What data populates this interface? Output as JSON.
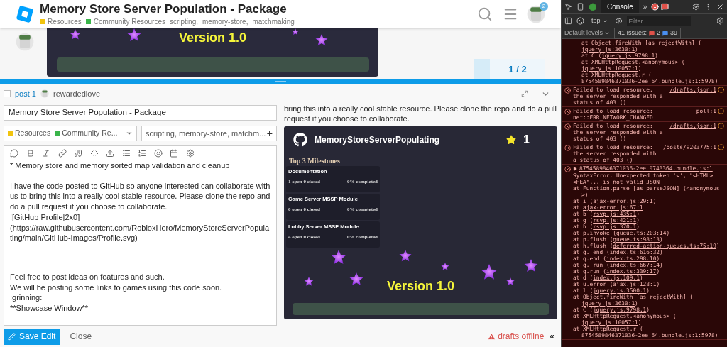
{
  "header": {
    "title": "Memory Store Server Population - Package",
    "categories": [
      {
        "name": "Resources",
        "color": "#f1c40f"
      },
      {
        "name": "Community Resources",
        "color": "#3ab54a"
      }
    ],
    "tags": [
      "scripting,",
      "memory-store,",
      "matchmaking"
    ],
    "notification_count": "2"
  },
  "topic_preview": {
    "version": "Version 1.0"
  },
  "timeline": {
    "position": "1 / 2"
  },
  "composer": {
    "post_link": "post 1",
    "username": "rewardedlove",
    "title_value": "Memory Store Server Population - Package",
    "category_select": [
      {
        "name": "Resources",
        "color": "#f1c40f"
      },
      {
        "name": "Community Re...",
        "color": "#3ab54a"
      }
    ],
    "tags_value": "scripting, memory-store, matchm...",
    "add_tag_label": "+",
    "editor_blocks": [
      {
        "kind": "paragraph",
        "lines": [
          "*  Memory store and memory sorted map validation and cleanup"
        ]
      },
      {
        "kind": "paragraph",
        "lines": [
          "I have the code posted to GitHub so anyone interested can collaborate with us to bring this into a really cool stable resource. Please clone the repo and do a pull request if you choose to collaborate.",
          "![GitHub Profile|2x0]",
          "(https://raw.githubusercontent.com/RobloxHero/MemoryStoreServerPopulating/main/GitHub-Images/Profile.svg)"
        ]
      },
      {
        "kind": "section",
        "lines": [
          "Feel free to post ideas on features and such.",
          "We will be posting some links to games using this code soon.",
          ":grinning:",
          "**Showcase Window**"
        ]
      }
    ],
    "save_label": "Save Edit",
    "close_label": "Close",
    "drafts_status": "drafts offline",
    "toggle_preview": "«"
  },
  "preview": {
    "text": "bring this into a really cool stable resource. Please clone the repo and do a pull request if you choose to collaborate.",
    "repo_card": {
      "name": "MemoryStoreServerPopulating",
      "stars": "1",
      "milestones_title": "Top 3 Milestones",
      "milestones": [
        {
          "title": "Documentation",
          "counts": "1 open 0 closed",
          "progress": "0% completed"
        },
        {
          "title": "Game Server MSSP Module",
          "counts": "0 open 0 closed",
          "progress": "0% completed"
        },
        {
          "title": "Lobby Server MSSP Module",
          "counts": "4 open 0 closed",
          "progress": "0% completed"
        }
      ],
      "version": "Version 1.0"
    }
  },
  "devtools": {
    "tabs": [
      {
        "label": "Console",
        "selected": true
      }
    ],
    "more_tabs": "»",
    "context": "top",
    "filter_placeholder": "Filter",
    "levels": "Default levels",
    "issues_label": "41 Issues:",
    "issues_errors": "2",
    "issues_info": "39",
    "messages": [
      {
        "kind": "trace",
        "lines": [
          {
            "text": "at Object.fireWith [as rejectWith] (",
            "link": "jquery.js:3630:1",
            "tail": ")"
          },
          {
            "text": "at C (",
            "link": "jquery.js:9798:1",
            "tail": ")"
          },
          {
            "text": "at XMLHttpRequest.<anonymous> (",
            "link": "jquery.js:10057:1",
            "tail": ")"
          },
          {
            "text": "at XMLHttpRequest.r (",
            "link": "8754589846371036-2ee_64.bundle.js:1:5978",
            "tail": ")"
          }
        ]
      },
      {
        "kind": "error",
        "text": "Failed to load resource: the server responded with a status of 403 ()",
        "source": "/drafts.json:1"
      },
      {
        "kind": "error",
        "text": "Failed to load resource: net::ERR_NETWORK_CHANGED",
        "source": "poll:1"
      },
      {
        "kind": "error",
        "text": "Failed to load resource: the server responded with a status of 403 ()",
        "source": "/drafts.json:1"
      },
      {
        "kind": "error",
        "text": "Failed to load resource: the server responded with a status of 403 ()",
        "source": "/posts/9203775:1"
      },
      {
        "kind": "exception",
        "source": "8754589846371036-2ee_0743364.bundle.js:1",
        "text": "SyntaxError: Unexpected token '<', \"<HTML><HEA\"... is not valid JSON",
        "lines": [
          {
            "text": "at Function.parse [as parseJSON] (<anonymous>)"
          },
          {
            "text": "at i (",
            "link": "ajax-error.js:29:1",
            "tail": ")"
          },
          {
            "text": "at ",
            "link": "ajax-error.js:67:1"
          },
          {
            "text": "at b (",
            "link": "rsvp.js:435:1",
            "tail": ")"
          },
          {
            "text": "at g (",
            "link": "rsvp.js:421:1",
            "tail": ")"
          },
          {
            "text": "at h (",
            "link": "rsvp.js:370:1",
            "tail": ")"
          },
          {
            "text": "at p.invoke (",
            "link": "queue.ts:203:14",
            "tail": ")"
          },
          {
            "text": "at p.flush (",
            "link": "queue.ts:98:13",
            "tail": ")"
          },
          {
            "text": "at h.flush (",
            "link": "deferred-action-queues.ts:75:19",
            "tail": ")"
          },
          {
            "text": "at q._end (",
            "link": "index.ts:616:32",
            "tail": ")"
          },
          {
            "text": "at q.end (",
            "link": "index.ts:298:10",
            "tail": ")"
          },
          {
            "text": "at q._run (",
            "link": "index.ts:667:14",
            "tail": ")"
          },
          {
            "text": "at q.run (",
            "link": "index.ts:339:17",
            "tail": ")"
          },
          {
            "text": "at d (",
            "link": "index.js:109:1",
            "tail": ")"
          },
          {
            "text": "at u.error (",
            "link": "ajax.js:128:1",
            "tail": ")"
          },
          {
            "text": "at l (",
            "link": "jquery.js:3500:1",
            "tail": ")"
          },
          {
            "text": "at Object.fireWith [as rejectWith] (",
            "link": "jquery.js:3630:1",
            "tail": ")"
          },
          {
            "text": "at C (",
            "link": "jquery.js:9798:1",
            "tail": ")"
          },
          {
            "text": "at XMLHttpRequest.<anonymous> (",
            "link": "jquery.js:10057:1",
            "tail": ")"
          },
          {
            "text": "at XMLHttpRequest.r (",
            "link": "8754589846371036-2ee_64.bundle.js:1:5978",
            "tail": ")"
          }
        ]
      }
    ]
  }
}
